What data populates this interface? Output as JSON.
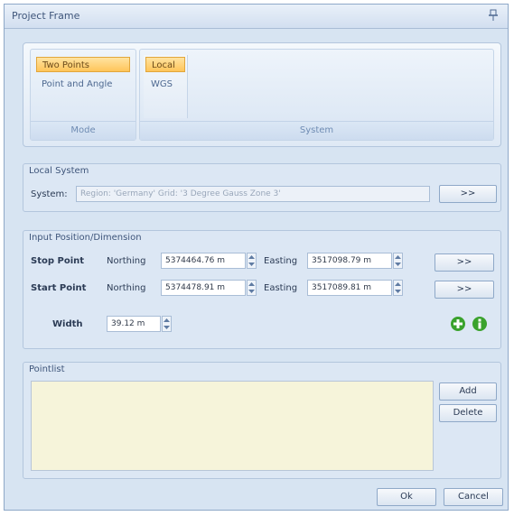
{
  "window": {
    "title": "Project Frame",
    "pin_icon": "pin-icon"
  },
  "ribbon": {
    "mode": {
      "items": [
        {
          "label": "Two Points",
          "selected": true
        },
        {
          "label": "Point and Angle",
          "selected": false
        }
      ],
      "footer": "Mode"
    },
    "system": {
      "items": [
        {
          "label": "Local",
          "selected": true
        },
        {
          "label": "WGS",
          "selected": false
        }
      ],
      "footer": "System"
    }
  },
  "local_system": {
    "title": "Local System",
    "system_label": "System:",
    "system_value": "Region: 'Germany'   Grid: '3 Degree Gauss Zone 3'",
    "browse_label": ">>"
  },
  "input": {
    "title": "Input Position/Dimension",
    "stop_point": {
      "label": "Stop Point",
      "northing_label": "Northing",
      "northing": "5374464.76 m",
      "easting_label": "Easting",
      "easting": "3517098.79 m",
      "browse_label": ">>"
    },
    "start_point": {
      "label": "Start Point",
      "northing_label": "Northing",
      "northing": "5374478.91 m",
      "easting_label": "Easting",
      "easting": "3517089.81 m",
      "browse_label": ">>"
    },
    "width": {
      "label": "Width",
      "value": "39.12 m"
    },
    "icons": [
      "add-circle-icon",
      "info-circle-icon"
    ],
    "colors": {
      "green": "#3aa22d"
    }
  },
  "pointlist": {
    "title": "Pointlist",
    "add_label": "Add",
    "delete_label": "Delete"
  },
  "footer": {
    "ok_label": "Ok",
    "cancel_label": "Cancel"
  }
}
